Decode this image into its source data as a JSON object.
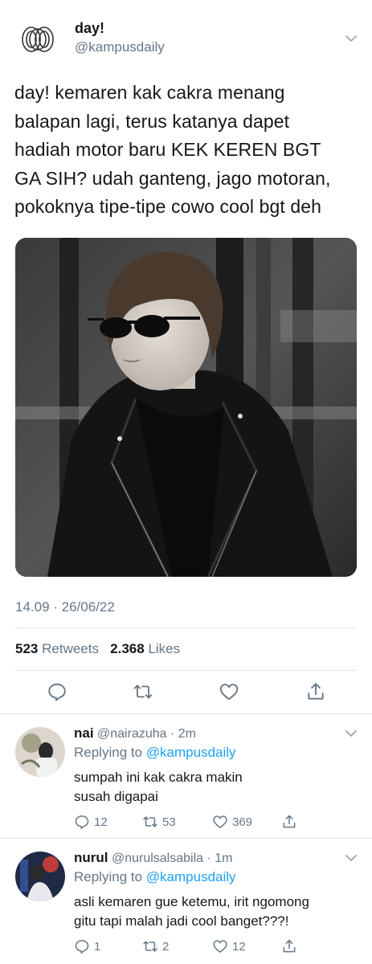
{
  "main_tweet": {
    "name": "day!",
    "handle": "@kampusdaily",
    "text_lines": [
      "day! kemaren kak cakra menang",
      "balapan lagi, terus katanya dapet",
      "hadiah motor baru KEK KEREN BGT",
      "GA SIH? udah ganteng, jago motoran,",
      "pokoknya tipe-tipe cowo cool bgt deh"
    ],
    "timestamp": "14.09 · 26/06/22",
    "retweets_count": "523",
    "retweets_label": "Retweets",
    "likes_count": "2.368",
    "likes_label": "Likes"
  },
  "replies": [
    {
      "name": "nai",
      "handle": "@nairazuha",
      "time": "· 2m",
      "replying_prefix": "Replying to",
      "replying_to": "@kampusdaily",
      "text_lines": [
        "sumpah ini kak cakra makin",
        "susah digapai"
      ],
      "reply_count": "12",
      "retweet_count": "53",
      "like_count": "369"
    },
    {
      "name": "nurul",
      "handle": "@nurulsalsabila",
      "time": "· 1m",
      "replying_prefix": "Replying to",
      "replying_to": "@kampusdaily",
      "text_lines": [
        "asli kemaren gue ketemu, irit ngomong",
        "gitu tapi malah jadi cool banget???!"
      ],
      "reply_count": "1",
      "retweet_count": "2",
      "like_count": "12"
    }
  ],
  "icons": {
    "reply": "comment-icon",
    "retweet": "retweet-icon",
    "like": "heart-icon",
    "share": "share-icon",
    "more": "chevron-down-icon"
  },
  "colors": {
    "link": "#1da1f2",
    "muted": "#657786",
    "text": "#14171a",
    "divider": "#e1e8ed"
  }
}
